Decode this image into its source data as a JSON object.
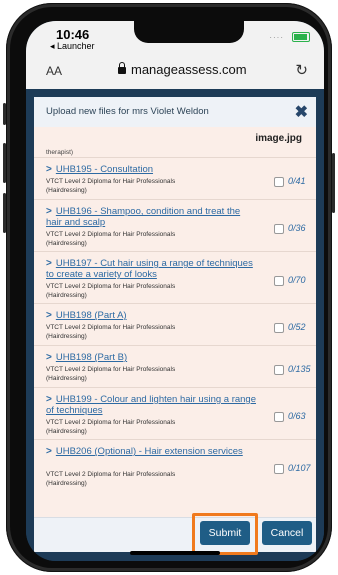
{
  "status": {
    "time": "10:46",
    "back_app": "◂ Launcher"
  },
  "browser": {
    "aa": "AA",
    "url": "manageassess.com"
  },
  "modal": {
    "title": "Upload new files for mrs Violet Weldon",
    "column_header": "image.jpg",
    "clipped_text": "therapist)",
    "units": [
      {
        "code": "UHB195 - Consultation",
        "qualification": "VTCT Level 2 Diploma for Hair Professionals",
        "category": "(Hairdressing)",
        "count": "0/41"
      },
      {
        "code": "UHB196 - Shampoo, condition and treat the hair and scalp",
        "qualification": "VTCT Level 2 Diploma for Hair Professionals",
        "category": "(Hairdressing)",
        "count": "0/36"
      },
      {
        "code": "UHB197 - Cut hair using a range of techniques to create a variety of looks",
        "qualification": "VTCT Level 2 Diploma for Hair Professionals",
        "category": "(Hairdressing)",
        "count": "0/70"
      },
      {
        "code": "UHB198 (Part A)",
        "qualification": "VTCT Level 2 Diploma for Hair Professionals",
        "category": "(Hairdressing)",
        "count": "0/52"
      },
      {
        "code": "UHB198 (Part B)",
        "qualification": "VTCT Level 2 Diploma for Hair Professionals",
        "category": "(Hairdressing)",
        "count": "0/135"
      },
      {
        "code": "UHB199 - Colour and lighten hair using a range of techniques",
        "qualification": "VTCT Level 2 Diploma for Hair Professionals",
        "category": "(Hairdressing)",
        "count": "0/63"
      },
      {
        "code": "UHB206 (Optional) - Hair extension services",
        "qualification": "VTCT Level 2 Diploma for Hair Professionals",
        "category": "(Hairdressing)",
        "count": "0/107"
      }
    ],
    "submit_label": "Submit",
    "cancel_label": "Cancel",
    "close_symbol": "✖"
  },
  "colors": {
    "accent": "#1f5d86",
    "highlight": "#f07a1e",
    "link": "#2d6aa3"
  }
}
